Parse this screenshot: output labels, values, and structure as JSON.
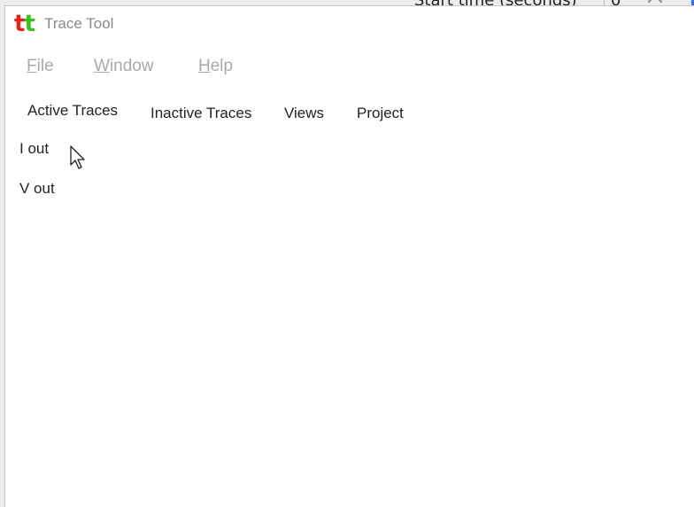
{
  "backdrop": {
    "label_fragment": "Start time (seconds)",
    "value_fragment": "0"
  },
  "app": {
    "logo_letters": [
      "t",
      "t"
    ],
    "title": "Trace Tool"
  },
  "menu": {
    "items": [
      {
        "mnemonic": "F",
        "rest": "ile"
      },
      {
        "mnemonic": "W",
        "rest": "indow"
      },
      {
        "mnemonic": "H",
        "rest": "elp"
      }
    ]
  },
  "tabs": [
    {
      "label": "Active Traces",
      "selected": true
    },
    {
      "label": "Inactive Traces",
      "selected": false
    },
    {
      "label": "Views",
      "selected": false
    },
    {
      "label": "Project",
      "selected": false
    }
  ],
  "traces": [
    {
      "label": "I out"
    },
    {
      "label": "V out"
    }
  ],
  "colors": {
    "logo_t1": "#e8221b",
    "logo_t2": "#3ac21a",
    "menu_text_disabled": "#a8a8a8",
    "title_text": "#8a8a8a"
  }
}
